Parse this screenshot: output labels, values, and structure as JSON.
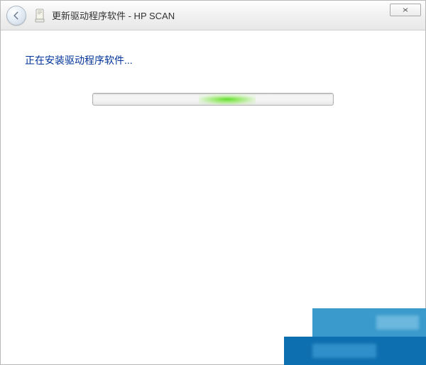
{
  "titlebar": {
    "title": "更新驱动程序软件 - HP SCAN"
  },
  "content": {
    "status": "正在安装驱动程序软件..."
  }
}
